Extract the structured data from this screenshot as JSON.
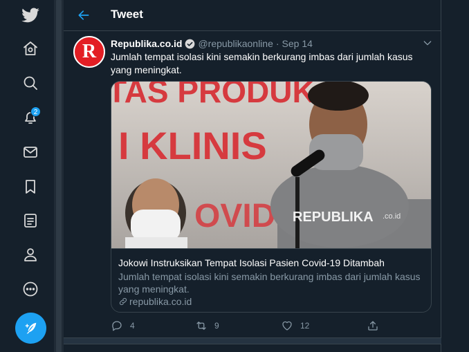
{
  "colors": {
    "background": "#15202b",
    "accent": "#1da1f2",
    "muted": "#8899a6",
    "border": "#38444d",
    "brand_red": "#e31e24"
  },
  "nav": {
    "items": [
      {
        "icon": "twitter-bird-icon"
      },
      {
        "icon": "home-icon"
      },
      {
        "icon": "search-icon"
      },
      {
        "icon": "notifications-icon",
        "badge": "2"
      },
      {
        "icon": "messages-icon"
      },
      {
        "icon": "bookmarks-icon"
      },
      {
        "icon": "lists-icon"
      },
      {
        "icon": "profile-icon"
      },
      {
        "icon": "more-icon"
      }
    ],
    "compose_icon": "compose-tweet-icon"
  },
  "header": {
    "title": "Tweet",
    "back_icon": "back-arrow-icon"
  },
  "tweet": {
    "avatar_letter": "R",
    "author_name": "Republika.co.id",
    "handle": "@republikaonline",
    "separator": "·",
    "date": "Sep 14",
    "text": "Jumlah tempat isolasi kini semakin berkurang imbas dari jumlah kasus yang meningkat.",
    "card": {
      "image_text_1": "TAS PRODUK",
      "image_text_2": "I KLINIS",
      "image_text_3": "OVID",
      "image_watermark": "REPUBLIKA",
      "image_watermark_suffix": ".co.id",
      "title": "Jokowi Instruksikan Tempat Isolasi Pasien Covid-19 Ditambah",
      "description": "Jumlah tempat isolasi kini semakin berkurang imbas dari jumlah kasus yang meningkat.",
      "domain": "republika.co.id"
    },
    "stats": {
      "replies": "4",
      "retweets": "9",
      "likes": "12"
    }
  }
}
